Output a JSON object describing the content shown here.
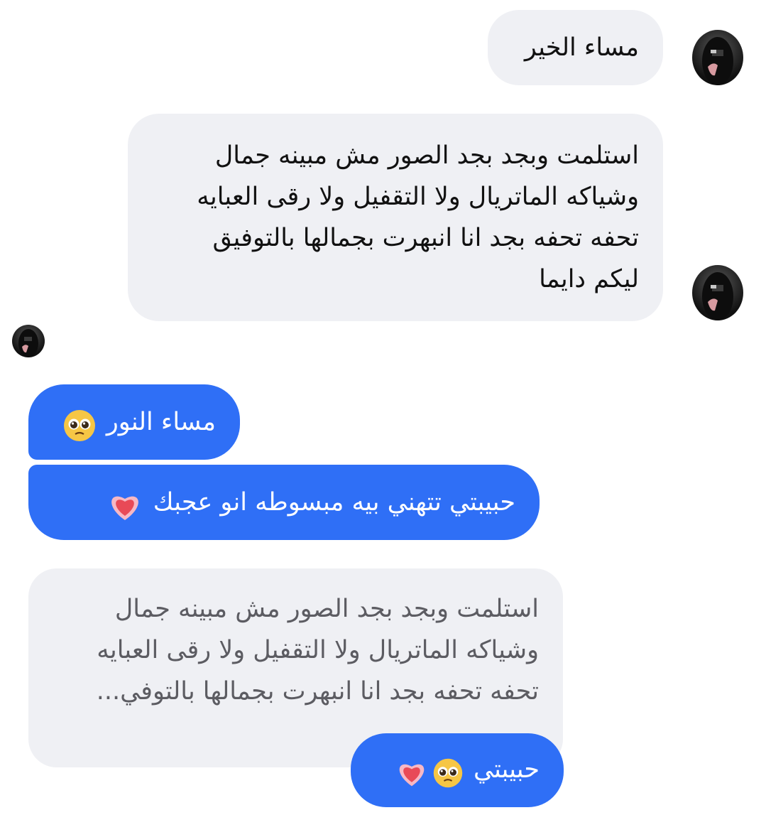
{
  "messages": {
    "received_1": {
      "text": "مساء الخير"
    },
    "received_2": {
      "lines": [
        "استلمت وبجد بجد الصور مش مبينه جمال",
        "وشياكه الماتريال ولا التقفيل ولا رقى العبايه",
        "تحفه تحفه بجد انا انبهرت بجمالها بالتوفيق",
        "ليكم دايما"
      ]
    },
    "sent_1": {
      "text": "مساء النور",
      "emoji": "pleading-face-emoji"
    },
    "sent_2": {
      "text": "حبيبتي تتهني بيه مبسوطه انو عجبك",
      "emoji": "heart-emoji"
    },
    "reply": {
      "quoted_lines": [
        "استلمت وبجد بجد الصور مش مبينه جمال",
        "وشياكه الماتريال ولا التقفيل ولا رقى العبايه",
        "تحفه تحفه بجد انا انبهرت بجمالها بالتوفي..."
      ],
      "text": "حبيبتي",
      "emojis": [
        "pleading-face-emoji",
        "heart-emoji"
      ]
    }
  },
  "colors": {
    "sent_bubble": "#2f6ff6",
    "received_bubble": "#eff0f4",
    "quoted_text": "#5c5c62"
  }
}
